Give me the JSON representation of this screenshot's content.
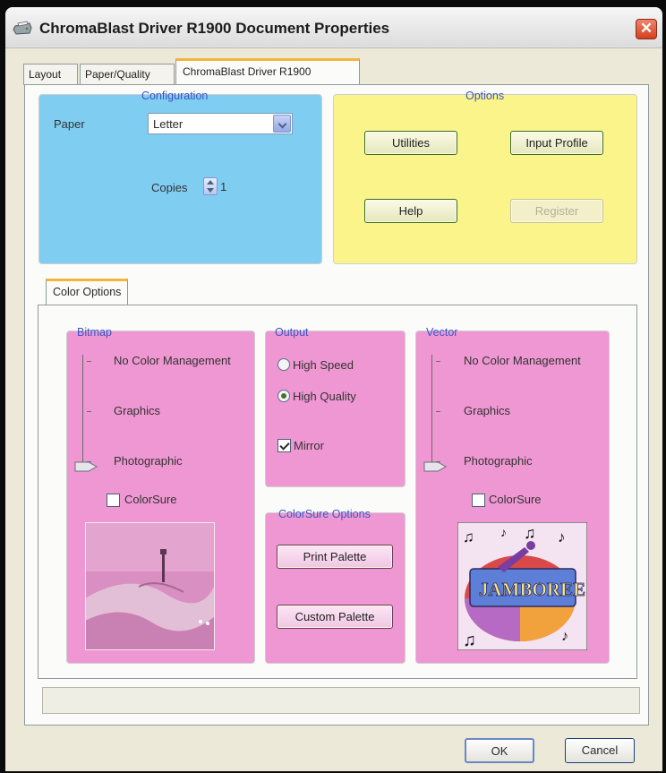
{
  "window": {
    "title": "ChromaBlast Driver R1900 Document Properties",
    "close_glyph": "✕"
  },
  "tabs": [
    {
      "label": "Layout"
    },
    {
      "label": "Paper/Quality"
    },
    {
      "label": "ChromaBlast Driver R1900"
    }
  ],
  "configuration": {
    "legend": "Configuration",
    "paper_label": "Paper",
    "paper_value": "Letter",
    "copies_label": "Copies",
    "copies_value": "1"
  },
  "options": {
    "legend": "Options",
    "utilities": "Utilities",
    "input_profile": "Input Profile",
    "help": "Help",
    "register": "Register"
  },
  "color_options": {
    "tab_label": "Color Options",
    "bitmap": {
      "legend": "Bitmap",
      "levels": [
        "No Color Management",
        "Graphics",
        "Photographic"
      ],
      "selected_level": "Photographic",
      "colorsure_label": "ColorSure",
      "colorsure_checked": false
    },
    "output": {
      "legend": "Output",
      "high_speed": "High Speed",
      "high_quality": "High Quality",
      "selected": "High Quality",
      "mirror_label": "Mirror",
      "mirror_checked": true
    },
    "colorsure_options": {
      "legend": "ColorSure Options",
      "print_palette": "Print Palette",
      "custom_palette": "Custom Palette"
    },
    "vector": {
      "legend": "Vector",
      "levels": [
        "No Color Management",
        "Graphics",
        "Photographic"
      ],
      "selected_level": "Photographic",
      "colorsure_label": "ColorSure",
      "colorsure_checked": false,
      "preview_logo_text": "JAMBOREE"
    }
  },
  "footer": {
    "ok": "OK",
    "cancel": "Cancel"
  },
  "colors": {
    "config_bg": "#7fcdf1",
    "options_bg": "#faf48a",
    "color_groups_bg": "#ee97d2",
    "tab_accent": "#f3b53c"
  }
}
